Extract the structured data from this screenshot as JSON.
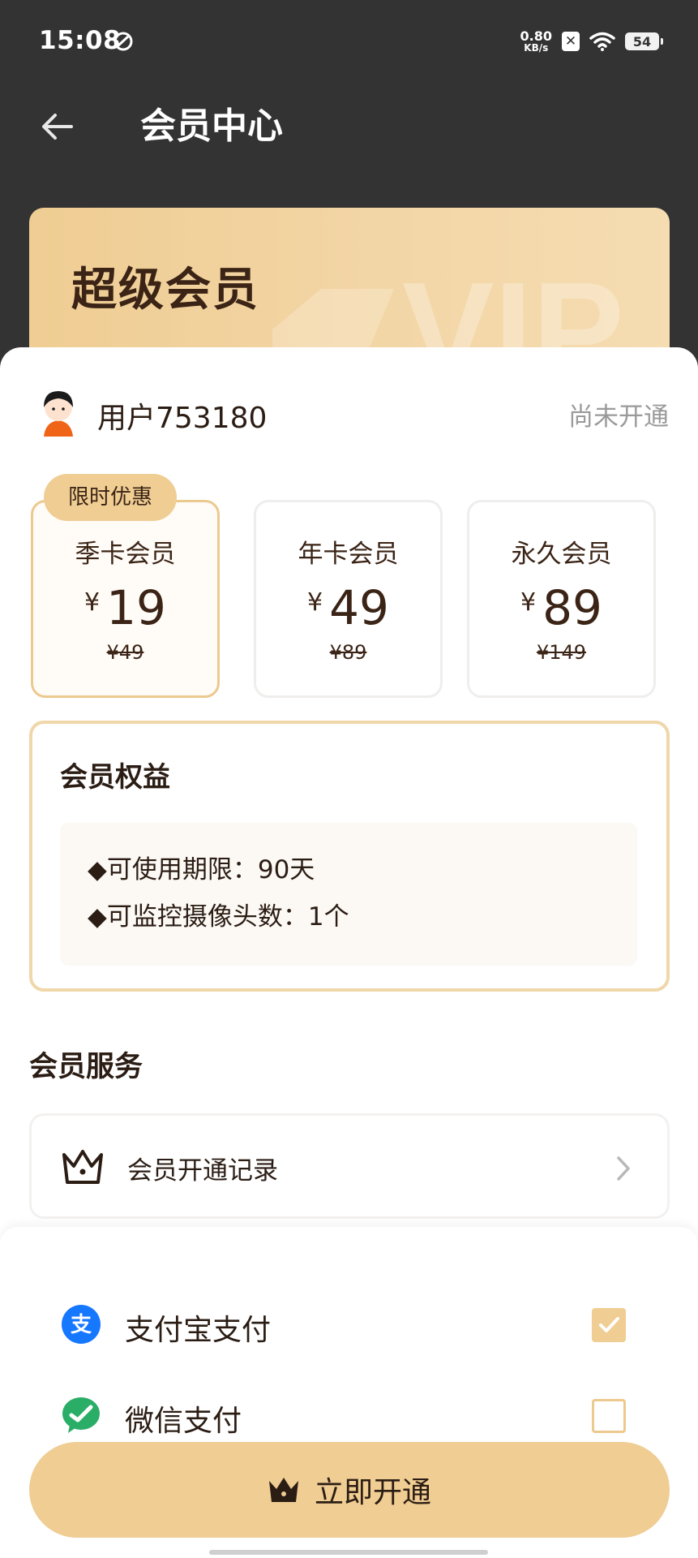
{
  "status_bar": {
    "time": "15:08",
    "net_speed_value": "0.80",
    "net_speed_unit": "KB/s",
    "notif_icon_char": "✕",
    "battery": "54"
  },
  "header": {
    "title": "会员中心"
  },
  "banner": {
    "title": "超级会员",
    "watermark": "VIP"
  },
  "user": {
    "name": "用户753180",
    "status": "尚未开通"
  },
  "plans": [
    {
      "name": "季卡会员",
      "currency": "¥",
      "price": "19",
      "original": "¥49",
      "badge": "限时优惠"
    },
    {
      "name": "年卡会员",
      "currency": "¥",
      "price": "49",
      "original": "¥89"
    },
    {
      "name": "永久会员",
      "currency": "¥",
      "price": "89",
      "original": "¥149"
    }
  ],
  "benefits": {
    "title": "会员权益",
    "items": [
      "◆可使用期限：90天",
      "◆可监控摄像头数：1个"
    ]
  },
  "services": {
    "title": "会员服务",
    "items": [
      {
        "label": "会员开通记录",
        "icon": "crown-icon"
      }
    ]
  },
  "payment": {
    "options": [
      {
        "label": "支付宝支付",
        "icon": "alipay-icon",
        "icon_char": "支",
        "checked": true
      },
      {
        "label": "微信支付",
        "icon": "wechat-icon",
        "checked": false
      }
    ]
  },
  "cta": {
    "label": "立即开通"
  },
  "colors": {
    "gold": "#efcd93",
    "dark_brown": "#3b2416",
    "top_bg": "#333333",
    "alipay_blue": "#1677ff",
    "wechat_green": "#2aae67"
  }
}
